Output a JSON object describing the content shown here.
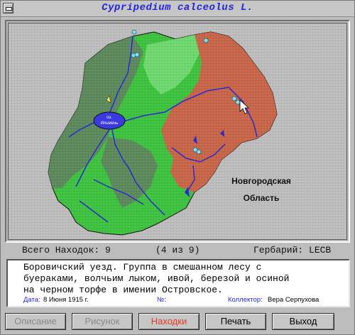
{
  "window": {
    "title": "Cypripedium calceolus L."
  },
  "map": {
    "region_label_line1": "Новгородская",
    "region_label_line2": "Область",
    "city_label_line1": "оз.",
    "city_label_line2": "Ильмень",
    "colors": {
      "forest_green": "#3fc23f",
      "light_green": "#6fd86f",
      "dark_green": "#5d8a5d",
      "red_brown": "#c8664a",
      "river": "#2a2ad0",
      "lake": "#3a3ae0",
      "find_marker": "#7fe0f0"
    }
  },
  "status": {
    "total_label": "Всего Находок: 9",
    "position": "(4 из 9)",
    "herbarium": "Гербарий: LECB"
  },
  "record": {
    "description_line1": "Боровичский уезд. Группа в смешанном лесу с",
    "description_line2": "буераками, волчьим лыком, ивой, березой и осиной",
    "description_line3": "на черном торфе в имении Островское.",
    "date_label": "Дата:",
    "date_value": "8 Июня 1915 г.",
    "number_label": "№:",
    "number_value": "",
    "collector_label": "Коллектор:",
    "collector_value": "Вера Серпухова"
  },
  "buttons": {
    "description": "Описание",
    "picture": "Рисунок",
    "finds": "Находки",
    "print": "Печать",
    "exit": "Выход"
  }
}
